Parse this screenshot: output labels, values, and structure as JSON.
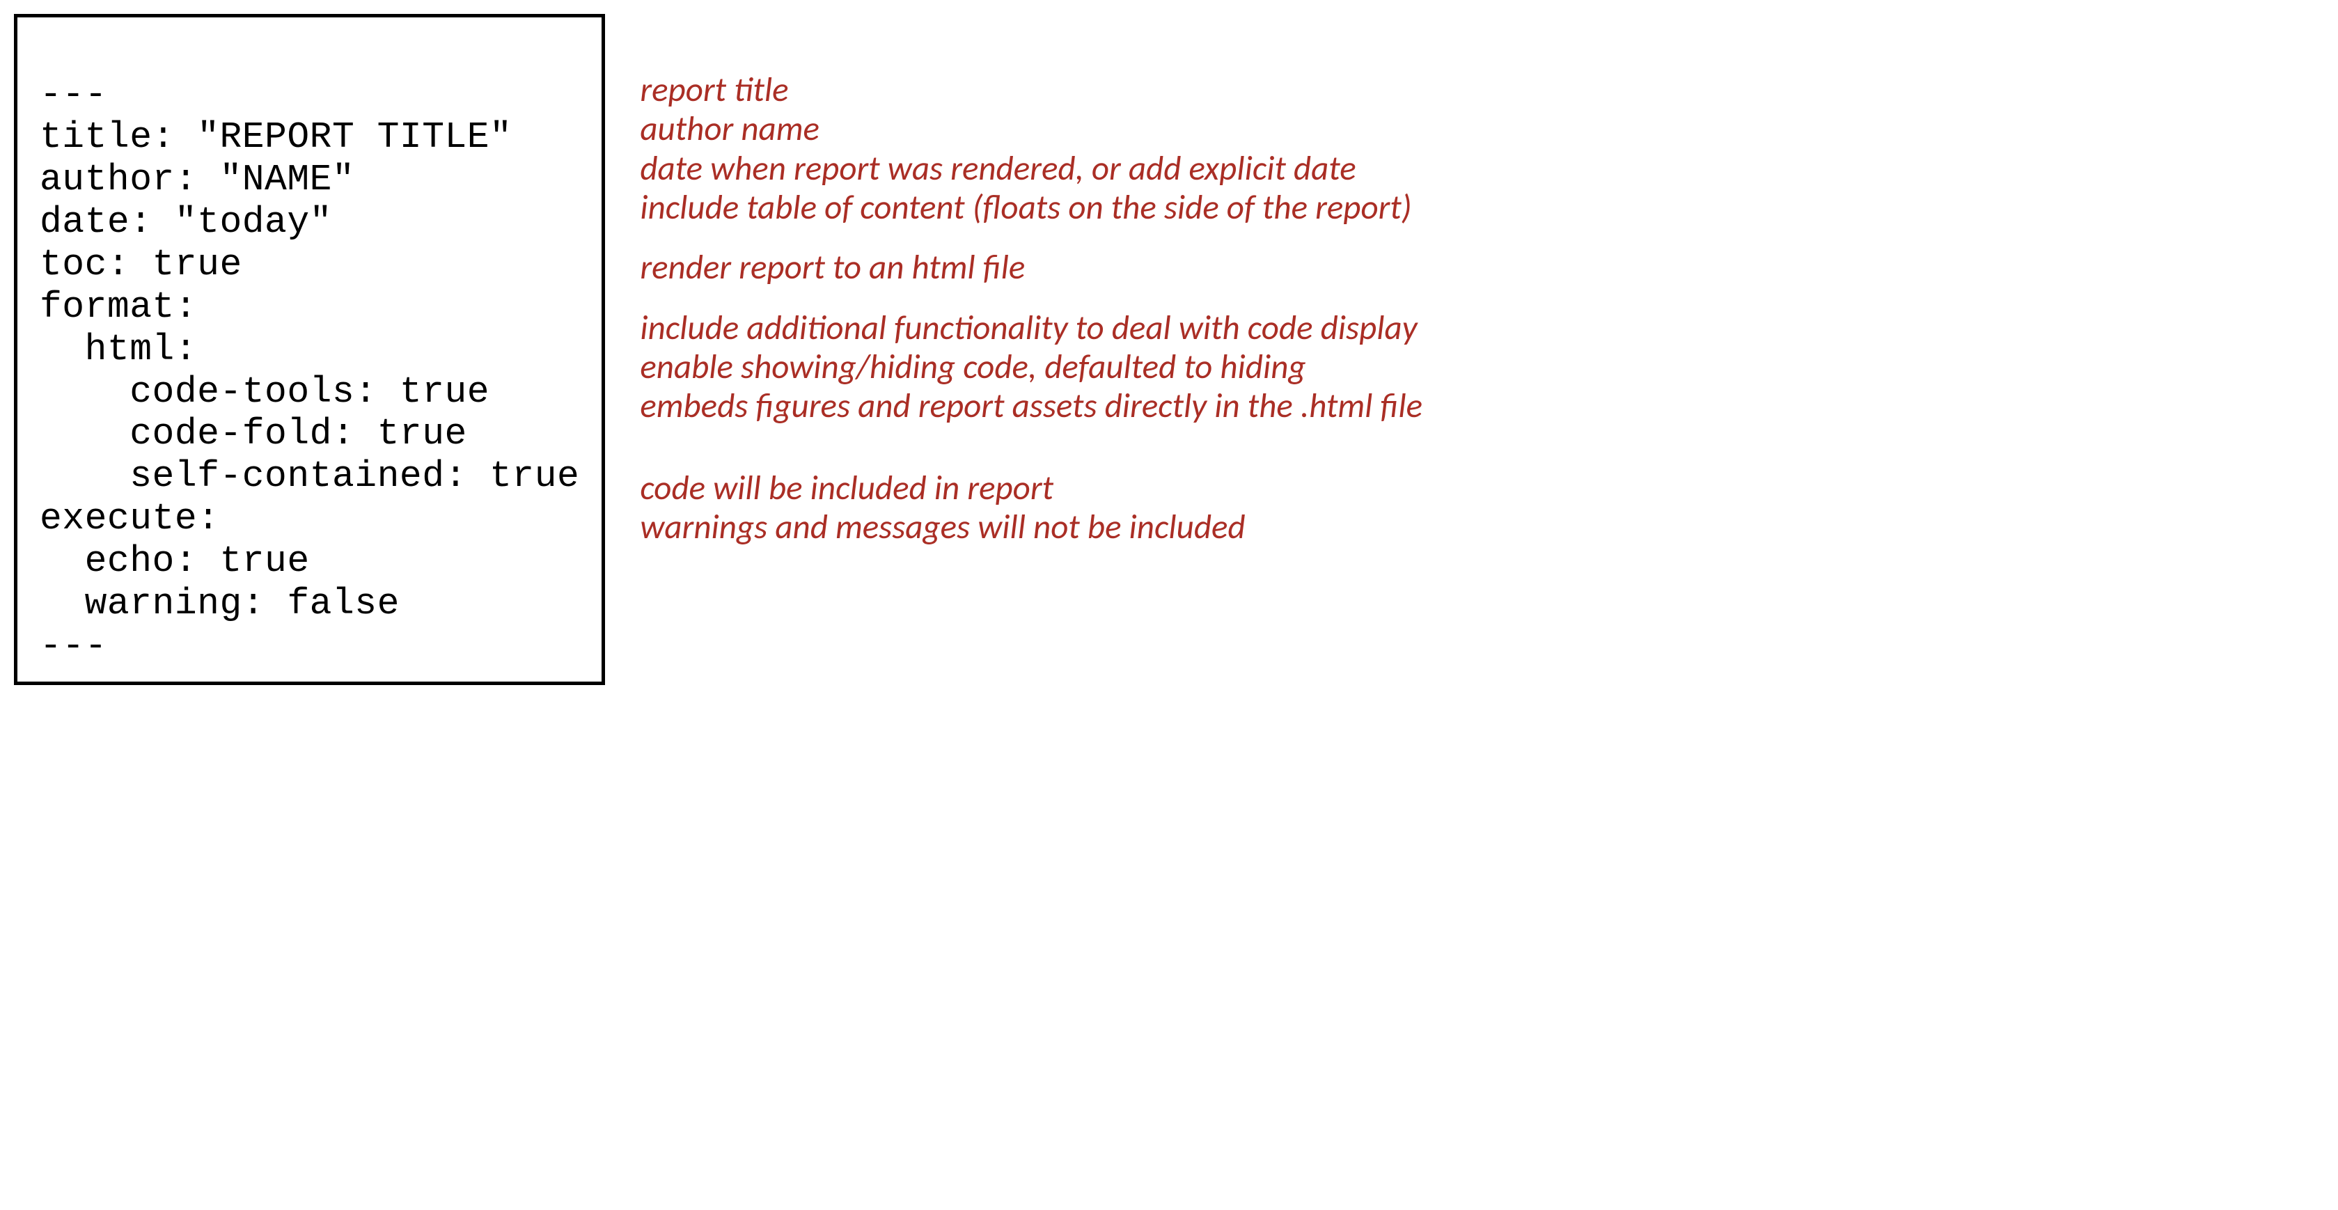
{
  "code": {
    "line1": "---",
    "line2": "title: \"REPORT TITLE\"",
    "line3": "author: \"NAME\"",
    "line4": "date: \"today\"",
    "line5": "toc: true",
    "line6": "format:",
    "line7": "  html:",
    "line8": "    code-tools: true",
    "line9": "    code-fold: true",
    "line10": "    self-contained: true",
    "line11": "execute:",
    "line12": "  echo: true",
    "line13": "  warning: false",
    "line14": "---"
  },
  "annotations": {
    "title": "report title",
    "author": "author name",
    "date": "date when report was rendered, or add explicit date",
    "toc": "include table of content (floats on the side of the report)",
    "format": "render report to an html file",
    "code_tools": "include additional functionality to deal with code display",
    "code_fold": "enable showing/hiding code, defaulted to hiding",
    "self_contained": "embeds figures and report assets directly in the .html file",
    "echo": "code will be included in report",
    "warning": "warnings and messages will not be included"
  }
}
